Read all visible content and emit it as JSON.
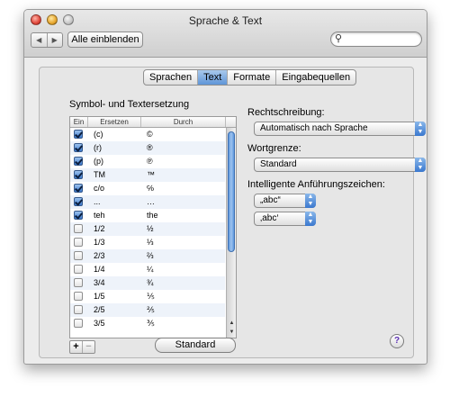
{
  "window": {
    "title": "Sprache & Text"
  },
  "toolbar": {
    "back_glyph": "◀",
    "forward_glyph": "▶",
    "show_all_label": "Alle einblenden",
    "search_value": "",
    "search_placeholder": ""
  },
  "tabs": [
    {
      "label": "Sprachen"
    },
    {
      "label": "Text",
      "active": true
    },
    {
      "label": "Formate"
    },
    {
      "label": "Eingabequellen"
    }
  ],
  "substitution": {
    "title": "Symbol- und Textersetzung",
    "columns": {
      "on": "Ein",
      "replace": "Ersetzen",
      "with": "Durch"
    },
    "rows": [
      {
        "on": true,
        "replace": "(c)",
        "with": "©"
      },
      {
        "on": true,
        "replace": "(r)",
        "with": "®"
      },
      {
        "on": true,
        "replace": "(p)",
        "with": "℗"
      },
      {
        "on": true,
        "replace": "TM",
        "with": "™"
      },
      {
        "on": true,
        "replace": "c/o",
        "with": "℅"
      },
      {
        "on": true,
        "replace": "...",
        "with": "…"
      },
      {
        "on": true,
        "replace": "teh",
        "with": "the"
      },
      {
        "on": false,
        "replace": "1/2",
        "with": "½"
      },
      {
        "on": false,
        "replace": "1/3",
        "with": "⅓"
      },
      {
        "on": false,
        "replace": "2/3",
        "with": "⅔"
      },
      {
        "on": false,
        "replace": "1/4",
        "with": "¼"
      },
      {
        "on": false,
        "replace": "3/4",
        "with": "¾"
      },
      {
        "on": false,
        "replace": "1/5",
        "with": "⅕"
      },
      {
        "on": false,
        "replace": "2/5",
        "with": "⅖"
      },
      {
        "on": false,
        "replace": "3/5",
        "with": "⅗"
      }
    ],
    "add_label": "+",
    "remove_label": "−",
    "standard_label": "Standard"
  },
  "right": {
    "spelling_label": "Rechtschreibung:",
    "spelling_value": "Automatisch nach Sprache",
    "wordbreak_label": "Wortgrenze:",
    "wordbreak_value": "Standard",
    "quotes_label": "Intelligente Anführungszeichen:",
    "double_quotes_value": "„abc“",
    "single_quotes_value": "‚abc‘"
  },
  "help_label": "?",
  "colors": {
    "accent": "#3b78cc",
    "help": "#5b2fb3"
  }
}
